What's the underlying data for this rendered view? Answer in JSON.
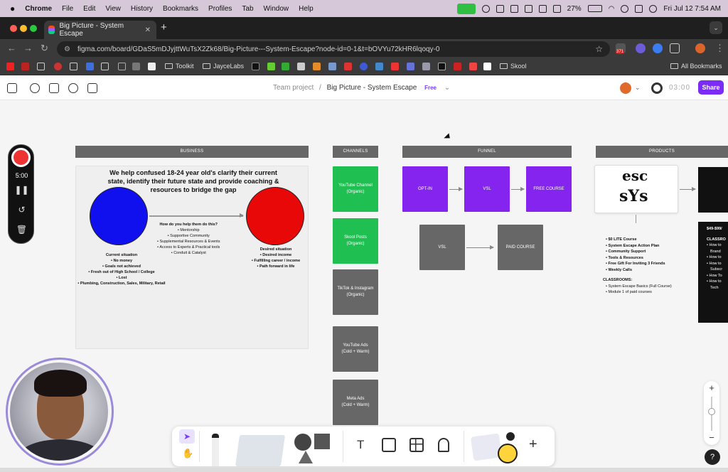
{
  "menubar": {
    "apple": "",
    "items": [
      "Chrome",
      "File",
      "Edit",
      "View",
      "History",
      "Bookmarks",
      "Profiles",
      "Tab",
      "Window",
      "Help"
    ],
    "battery": "27%",
    "datetime": "Fri Jul 12  7:54 AM"
  },
  "browser": {
    "tab_title": "Big Picture - System Escape",
    "new_tab": "+",
    "url": "figma.com/board/GDaS5mDJyjttWuTsX2Zk68/Big-Picture---System-Escape?node-id=0-1&t=bOVYu72kHR6lqoqy-0",
    "ext_badge": "371"
  },
  "bookmarks": {
    "items": [
      "Toolkit",
      "JayceLabs",
      "Skool"
    ],
    "all": "All Bookmarks"
  },
  "figma": {
    "team": "Team project",
    "separator": "/",
    "file": "Big Picture - System Escape",
    "plan": "Free",
    "timer": "03:00",
    "share": "Share"
  },
  "recorder": {
    "time": "5:00"
  },
  "board": {
    "sections": {
      "business": "BUSINESS",
      "channels": "CHANNELS",
      "funnel": "FUNNEL",
      "products": "PRODUCTS"
    },
    "business": {
      "headline": "We help confused 18-24 year old's clarify their current state, identify their future state and provide coaching & resources to bridge the gap",
      "how_title": "How do you help them do this?",
      "how": [
        "Mentorship",
        "Supportive Community",
        "Supplemental Resources & Events",
        "Access to Experts & Practical tools",
        "Conduit & Catalyst"
      ],
      "current_title": "Current situation",
      "current": [
        "No money",
        "Goals not achieved",
        "Fresh out of High School / College",
        "Lost",
        "Plumbing, Construction, Sales, Military, Retail"
      ],
      "desired_title": "Desired situation",
      "desired": [
        "Desired income",
        "Fulfilling career / income",
        "Path forward in life"
      ]
    },
    "channels": [
      {
        "name": "YouTube Channel",
        "sub": "(Organic)"
      },
      {
        "name": "Skool Posts",
        "sub": "(Organic)"
      },
      {
        "name": "TikTok & Instagram",
        "sub": "(Organic)"
      },
      {
        "name": "YouTube Ads",
        "sub": "(Cold + Warm)"
      },
      {
        "name": "Meta Ads",
        "sub": "(Cold + Warm)"
      }
    ],
    "funnel": {
      "row1": [
        "OPT-IN",
        "VSL",
        "FREE COURSE"
      ],
      "row2": [
        "VSL",
        "PAID COURSE"
      ]
    },
    "products": {
      "thumb_text": [
        "esc",
        "sYs"
      ],
      "lite": [
        "$0 LITE Course",
        "System Escape Action Plan",
        "Community Support",
        "Tools & Resources",
        "Free Gift For Inviting 3 Friends",
        "Weekly Calls"
      ],
      "classrooms_title": "CLASSROOMS:",
      "classrooms": [
        "System Escape Basics (Full Course)",
        "Module 1 of paid courses"
      ],
      "dark_price": "$49-$99/",
      "dark_title": "CLASSRO",
      "dark_items": [
        "How to",
        "Brand",
        "How to",
        "How to",
        "Subscr",
        "How To",
        "How to",
        "Tech"
      ]
    }
  },
  "toolbar": {
    "text_tool": "T",
    "add": "+"
  },
  "zoom": {
    "plus": "+",
    "minus": "−"
  },
  "help": "?"
}
